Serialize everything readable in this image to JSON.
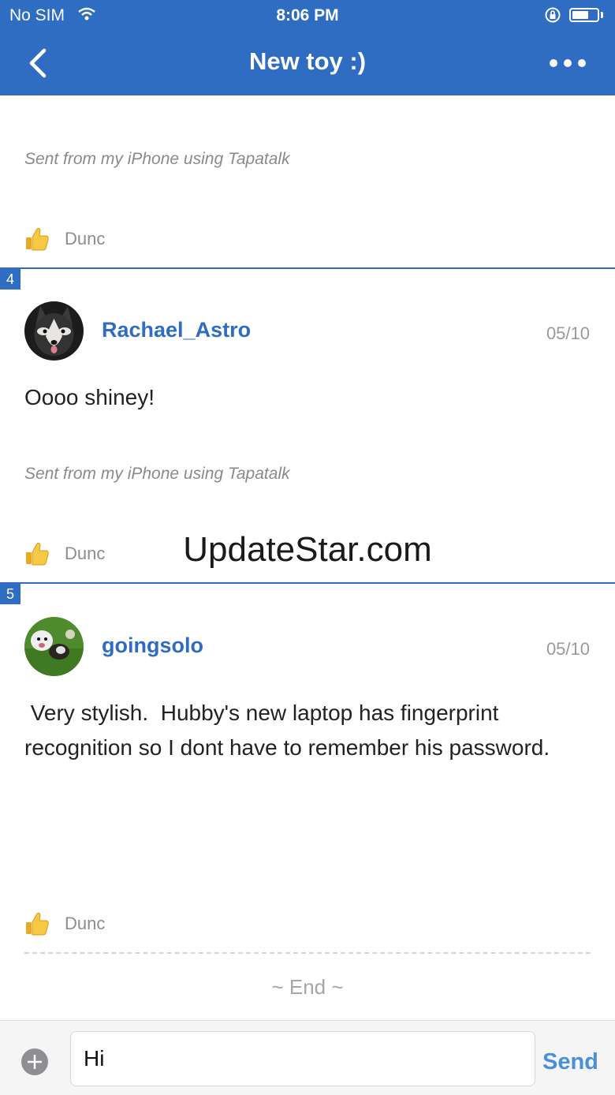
{
  "status_bar": {
    "carrier": "No SIM",
    "time": "8:06 PM",
    "battery_level": 0.65
  },
  "nav": {
    "title": "New toy :)"
  },
  "posts": [
    {
      "signature": "Sent from my iPhone using Tapatalk",
      "like_name": "Dunc"
    },
    {
      "floor": "4",
      "username": "Rachael_Astro",
      "date": "05/10",
      "body": "Oooo shiney!",
      "signature": "Sent from my iPhone using Tapatalk",
      "like_name": "Dunc"
    },
    {
      "floor": "5",
      "username": "goingsolo",
      "date": "05/10",
      "body": " Very stylish.  Hubby's new laptop has fingerprint recognition so I dont have to remember his password.",
      "like_name": "Dunc"
    }
  ],
  "watermark": "UpdateStar.com",
  "end_label": "~ End ~",
  "reply": {
    "value": "Hi",
    "send_label": "Send"
  },
  "colors": {
    "brand": "#2F6DC2",
    "send": "#4A90D9"
  }
}
